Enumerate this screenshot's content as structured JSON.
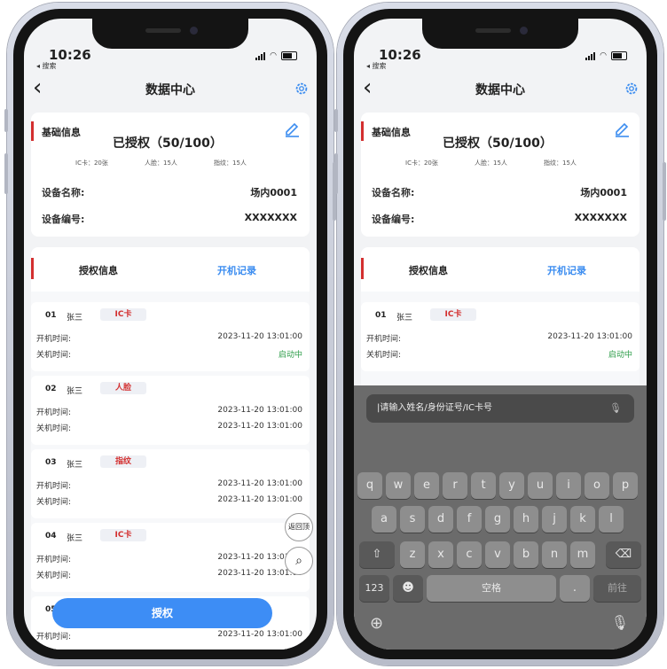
{
  "status": {
    "time": "10:26",
    "back_app": "◂ 搜索"
  },
  "nav": {
    "title": "数据中心"
  },
  "basic": {
    "label": "基础信息",
    "authorized": "已授权（50/100）",
    "ic_count": "IC卡：20张",
    "face_count": "人脸：15人",
    "finger_count": "指纹：15人",
    "device_name_label": "设备名称:",
    "device_name_value": "场内0001",
    "device_no_label": "设备编号:",
    "device_no_value": "XXXXXXX"
  },
  "auth": {
    "tab_info": "授权信息",
    "tab_records": "开机记录"
  },
  "records": [
    {
      "num": "01",
      "name": "张三",
      "type": "IC卡",
      "on_label": "开机时间:",
      "off_label": "关机时间:",
      "on_time": "2023-11-20  13:01:00",
      "off_time": "启动中"
    },
    {
      "num": "02",
      "name": "张三",
      "type": "人脸",
      "on_label": "开机时间:",
      "off_label": "关机时间:",
      "on_time": "2023-11-20  13:01:00",
      "off_time": "2023-11-20  13:01:00"
    },
    {
      "num": "03",
      "name": "张三",
      "type": "指纹",
      "on_label": "开机时间:",
      "off_label": "关机时间:",
      "on_time": "2023-11-20  13:01:00",
      "off_time": "2023-11-20  13:01:00"
    },
    {
      "num": "04",
      "name": "张三",
      "type": "IC卡",
      "on_label": "开机时间:",
      "off_label": "关机时间:",
      "on_time": "2023-11-20  13:01:00",
      "off_time": "2023-11-20  13:01:00"
    },
    {
      "num": "05",
      "on_label": "开机时间:",
      "on_time": "2023-11-20  13:01:00"
    }
  ],
  "fab": {
    "top_label": "返回顶部"
  },
  "auth_button": "授权",
  "keyboard": {
    "placeholder": "|请输入姓名/身份证号/IC卡号",
    "row1": [
      "q",
      "w",
      "e",
      "r",
      "t",
      "y",
      "u",
      "i",
      "o",
      "p"
    ],
    "row2": [
      "a",
      "s",
      "d",
      "f",
      "g",
      "h",
      "j",
      "k",
      "l"
    ],
    "row3": [
      "z",
      "x",
      "c",
      "v",
      "b",
      "n",
      "m"
    ],
    "num_key": "123",
    "space": "空格",
    "dot": ".",
    "go": "前往"
  },
  "colors": {
    "accent": "#3d8df5",
    "red": "#d32f2f",
    "green": "#2e9d4a"
  }
}
